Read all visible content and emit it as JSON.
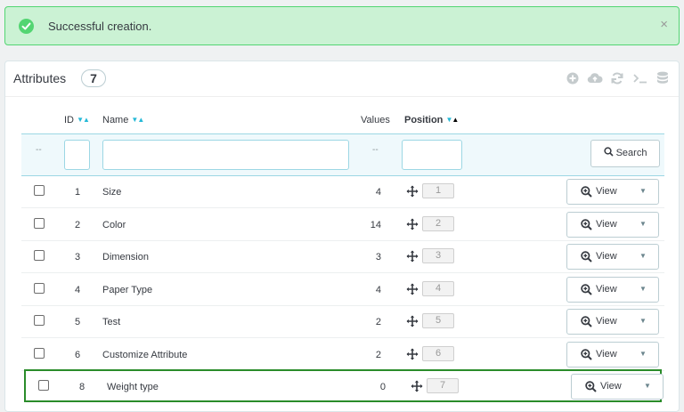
{
  "alert": {
    "message": "Successful creation.",
    "close": "×"
  },
  "panel": {
    "title": "Attributes",
    "count": "7"
  },
  "toolbar": [
    "add-new-icon",
    "cloud-upload-icon",
    "refresh-icon",
    "terminal-icon",
    "database-icon"
  ],
  "columns": {
    "id": "ID",
    "name": "Name",
    "values": "Values",
    "position": "Position"
  },
  "filters": {
    "placeholder_dash": "--",
    "search_label": "Search"
  },
  "rows": [
    {
      "id": "1",
      "name": "Size",
      "values": "4",
      "position": "1",
      "action": "View"
    },
    {
      "id": "2",
      "name": "Color",
      "values": "14",
      "position": "2",
      "action": "View"
    },
    {
      "id": "3",
      "name": "Dimension",
      "values": "3",
      "position": "3",
      "action": "View"
    },
    {
      "id": "4",
      "name": "Paper Type",
      "values": "4",
      "position": "4",
      "action": "View"
    },
    {
      "id": "5",
      "name": "Test",
      "values": "2",
      "position": "5",
      "action": "View"
    },
    {
      "id": "6",
      "name": "Customize Attribute",
      "values": "2",
      "position": "6",
      "action": "View"
    },
    {
      "id": "8",
      "name": "Weight type",
      "values": "0",
      "position": "7",
      "action": "View"
    }
  ],
  "colors": {
    "success_bg": "#cbf2d4",
    "success": "#53d572",
    "accent": "#25b9d7",
    "highlight": "#2a8c2a"
  }
}
